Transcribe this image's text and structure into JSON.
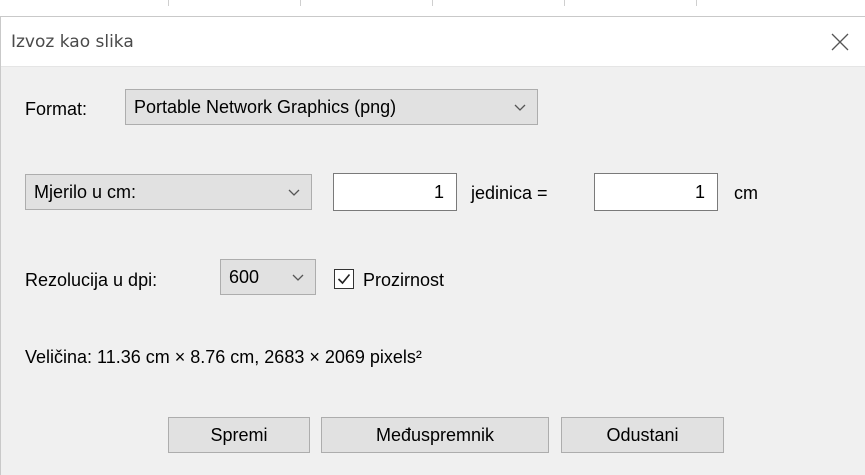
{
  "dialog": {
    "title": "Izvoz kao slika",
    "close_icon": "close-icon"
  },
  "format": {
    "label": "Format:",
    "selected": "Portable Network Graphics (png)"
  },
  "scale": {
    "mode_selected": "Mjerilo u cm:",
    "units_value": "1",
    "equals_label": "jedinica =",
    "cm_value": "1",
    "cm_label": "cm"
  },
  "resolution": {
    "label": "Rezolucija u dpi:",
    "selected": "600",
    "transparency_label": "Prozirnost",
    "transparency_checked": true
  },
  "size": {
    "text": "Veličina:  11.36 cm × 8.76 cm, 2683 × 2069 pixels²"
  },
  "buttons": {
    "save": "Spremi",
    "clipboard": "Međuspremnik",
    "cancel": "Odustani"
  },
  "colors": {
    "content_bg": "#f0f0f0",
    "button_bg": "#e1e1e1",
    "title_text": "#4a4a4a"
  }
}
